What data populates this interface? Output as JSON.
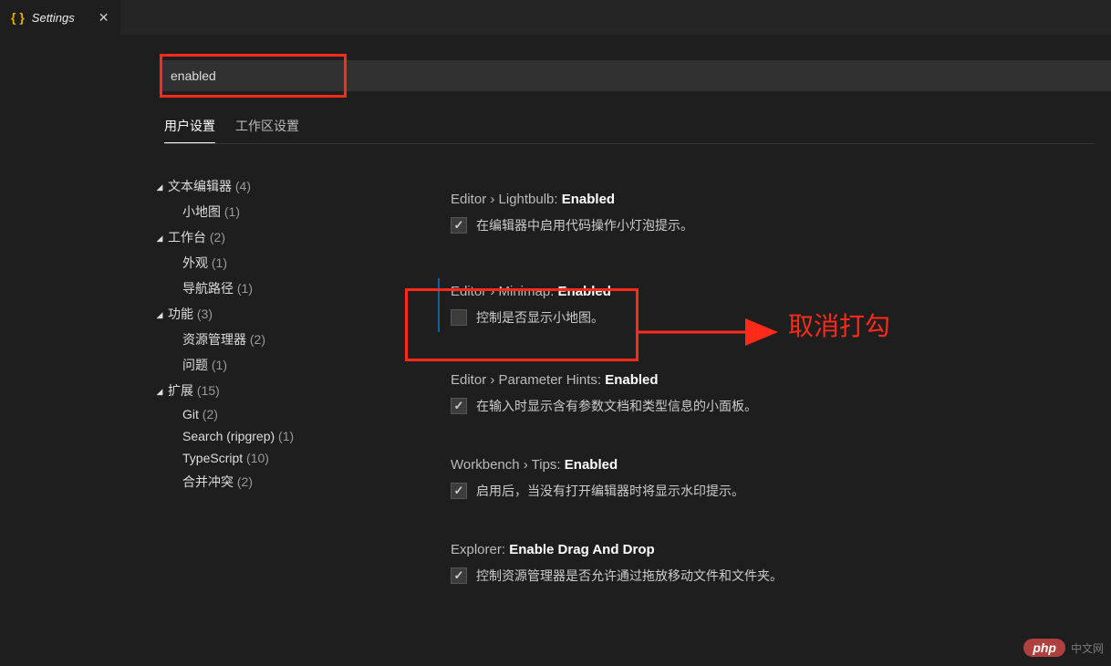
{
  "tab": {
    "title": "Settings"
  },
  "search": {
    "value": "enabled"
  },
  "subtabs": {
    "user": "用户设置",
    "workspace": "工作区设置"
  },
  "tree": {
    "textEditor": {
      "label": "文本编辑器",
      "count": "(4)"
    },
    "minimap": {
      "label": "小地图",
      "count": "(1)"
    },
    "workbench": {
      "label": "工作台",
      "count": "(2)"
    },
    "appearance": {
      "label": "外观",
      "count": "(1)"
    },
    "breadcrumbs": {
      "label": "导航路径",
      "count": "(1)"
    },
    "features": {
      "label": "功能",
      "count": "(3)"
    },
    "explorer": {
      "label": "资源管理器",
      "count": "(2)"
    },
    "problems": {
      "label": "问题",
      "count": "(1)"
    },
    "extensions": {
      "label": "扩展",
      "count": "(15)"
    },
    "git": {
      "label": "Git",
      "count": "(2)"
    },
    "search": {
      "label": "Search (ripgrep)",
      "count": "(1)"
    },
    "typescript": {
      "label": "TypeScript",
      "count": "(10)"
    },
    "merge": {
      "label": "合并冲突",
      "count": "(2)"
    }
  },
  "settings": {
    "lightbulb": {
      "path": "Editor › Lightbulb: ",
      "name": "Enabled",
      "desc": "在编辑器中启用代码操作小灯泡提示。"
    },
    "minimap": {
      "path": "Editor › Minimap: ",
      "name": "Enabled",
      "desc": "控制是否显示小地图。"
    },
    "paramHints": {
      "path": "Editor › Parameter Hints: ",
      "name": "Enabled",
      "desc": "在输入时显示含有参数文档和类型信息的小面板。"
    },
    "tips": {
      "path": "Workbench › Tips: ",
      "name": "Enabled",
      "desc": "启用后，当没有打开编辑器时将显示水印提示。"
    },
    "dragDrop": {
      "path": "Explorer: ",
      "name": "Enable Drag And Drop",
      "desc": "控制资源管理器是否允许通过拖放移动文件和文件夹。"
    }
  },
  "annotation": {
    "label": "取消打勾"
  },
  "watermark": {
    "pill": "php",
    "txt": "中文网"
  }
}
